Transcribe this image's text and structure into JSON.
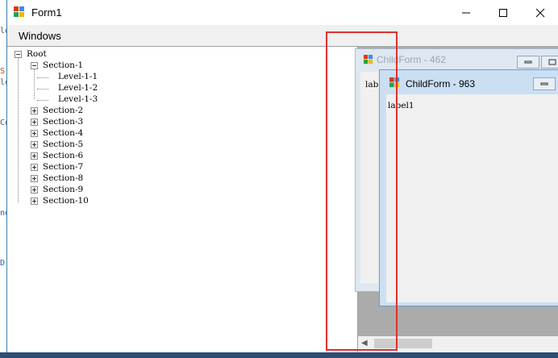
{
  "window": {
    "title": "Form1",
    "controls": [
      "minimize-icon",
      "maximize-icon",
      "close-icon"
    ]
  },
  "menu": {
    "items": [
      {
        "label": "Windows"
      }
    ]
  },
  "tree": {
    "root": "Root",
    "section1": "Section-1",
    "levels": [
      "Level-1-1",
      "Level-1-2",
      "Level-1-3"
    ],
    "sections": [
      "Section-2",
      "Section-3",
      "Section-4",
      "Section-5",
      "Section-6",
      "Section-7",
      "Section-8",
      "Section-9",
      "Section-10"
    ]
  },
  "child_forms": [
    {
      "title": "ChildForm - 462",
      "label": "lab"
    },
    {
      "title": "ChildForm - 963",
      "label": "label1"
    }
  ],
  "background_fragments": [
    "ld",
    "S",
    "le",
    "Co",
    "ne",
    "D"
  ],
  "colors": {
    "highlight": "#e03030",
    "mdi_background": "#ababab",
    "child_titlebar_active": "#cbdff3",
    "child_titlebar_inactive": "#dfe8f1"
  }
}
